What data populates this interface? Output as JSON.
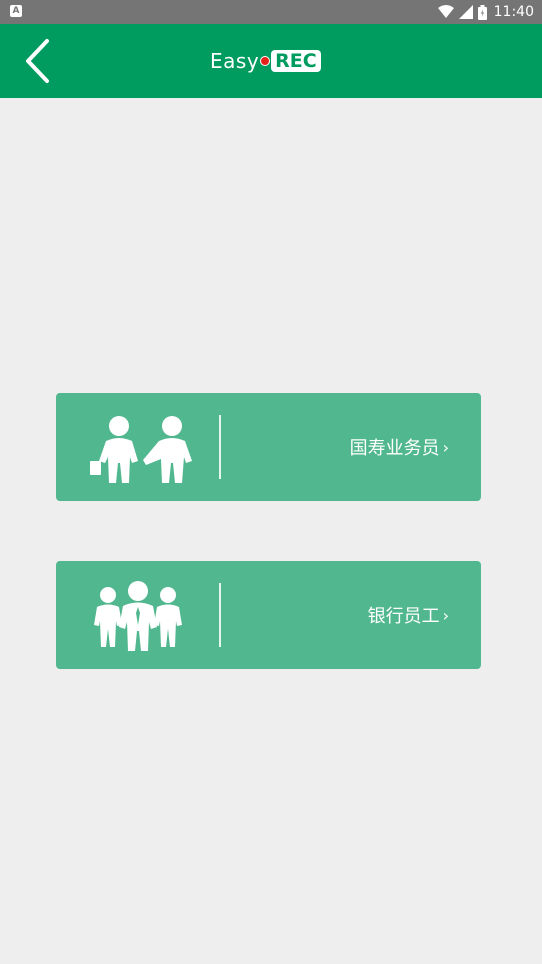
{
  "status_bar": {
    "time": "11:40",
    "notification_icon": "a-badge-icon",
    "icons": [
      "wifi-icon",
      "cell-signal-icon",
      "battery-icon"
    ]
  },
  "app_bar": {
    "back_icon": "chevron-left-icon",
    "logo_left": "Easy",
    "logo_right": "REC",
    "color": "#009c5f"
  },
  "cards": [
    {
      "label": "国寿业务员",
      "icon": "two-people-handshake-icon",
      "chevron": "›"
    },
    {
      "label": "银行员工",
      "icon": "group-of-people-icon",
      "chevron": "›"
    }
  ],
  "colors": {
    "card": "#50b78f",
    "background": "#eeeeee",
    "logo_dot": "#e5231b"
  }
}
